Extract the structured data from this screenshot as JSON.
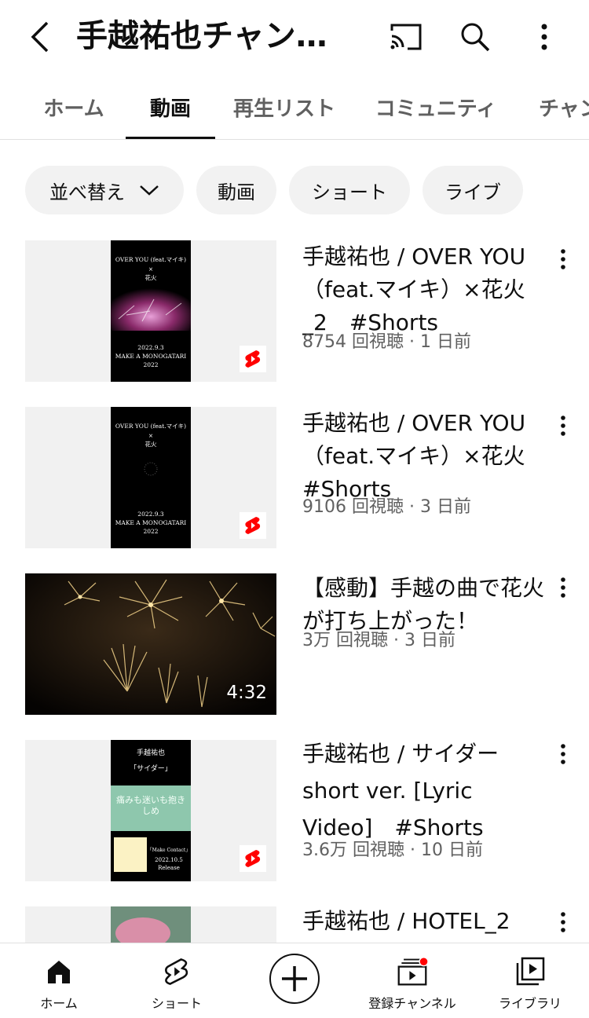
{
  "header": {
    "title": "手越祐也チャン…",
    "icons": [
      "back-icon",
      "cast-icon",
      "search-icon",
      "more-vert-icon"
    ]
  },
  "tabs": [
    {
      "label": "ホーム",
      "active": false
    },
    {
      "label": "動画",
      "active": true
    },
    {
      "label": "再生リスト",
      "active": false
    },
    {
      "label": "コミュニティ",
      "active": false
    },
    {
      "label": "チャンネル",
      "active": false
    }
  ],
  "chips": [
    {
      "label": "並べ替え"
    },
    {
      "label": "動画"
    },
    {
      "label": "ショート"
    },
    {
      "label": "ライブ"
    }
  ],
  "videos": [
    {
      "title": "手越祐也 / OVER YOU（feat.マイキ）×花火_2　#Shorts",
      "meta": "8754 回視聴 · 1 日前",
      "is_short": true,
      "thumb_text": {
        "top": "OVER YOU (feat.マイキ)",
        "x": "×",
        "sub": "花火",
        "date": "2022.9.3",
        "event": "MAKE A MONOGATARI",
        "year": "2022"
      }
    },
    {
      "title": "手越祐也 / OVER YOU（feat.マイキ）×花火　#Shorts",
      "meta": "9106 回視聴 · 3 日前",
      "is_short": true,
      "thumb_text": {
        "top": "OVER YOU (feat.マイキ)",
        "x": "×",
        "sub": "花火",
        "date": "2022.9.3",
        "event": "MAKE A MONOGATARI",
        "year": "2022"
      }
    },
    {
      "title": "【感動】手越の曲で花火が打ち上がった！",
      "meta": "3万 回視聴 · 3 日前",
      "is_short": false,
      "duration": "4:32"
    },
    {
      "title": "手越祐也 / サイダー short ver. [Lyric Video]　#Shorts",
      "meta": "3.6万 回視聴 · 10 日前",
      "is_short": true,
      "thumb_text": {
        "artist": "手越祐也",
        "song": "「サイダー」",
        "lyric": "痛みも迷いも抱きしめ",
        "album": "「Make Contact」",
        "release": "2022.10.5",
        "release_label": "Release"
      }
    },
    {
      "title": "手越祐也 / HOTEL_2",
      "meta": "",
      "is_short": true
    }
  ],
  "bottom_nav": [
    {
      "label": "ホーム",
      "icon": "home-icon"
    },
    {
      "label": "ショート",
      "icon": "shorts-icon"
    },
    {
      "label": "",
      "icon": "create-icon"
    },
    {
      "label": "登録チャンネル",
      "icon": "subscriptions-icon",
      "has_badge": true
    },
    {
      "label": "ライブラリ",
      "icon": "library-icon"
    }
  ],
  "colors": {
    "accent": "#ff0000",
    "text": "#0f0f0f",
    "meta": "#606060",
    "chip_bg": "#f2f2f2"
  }
}
